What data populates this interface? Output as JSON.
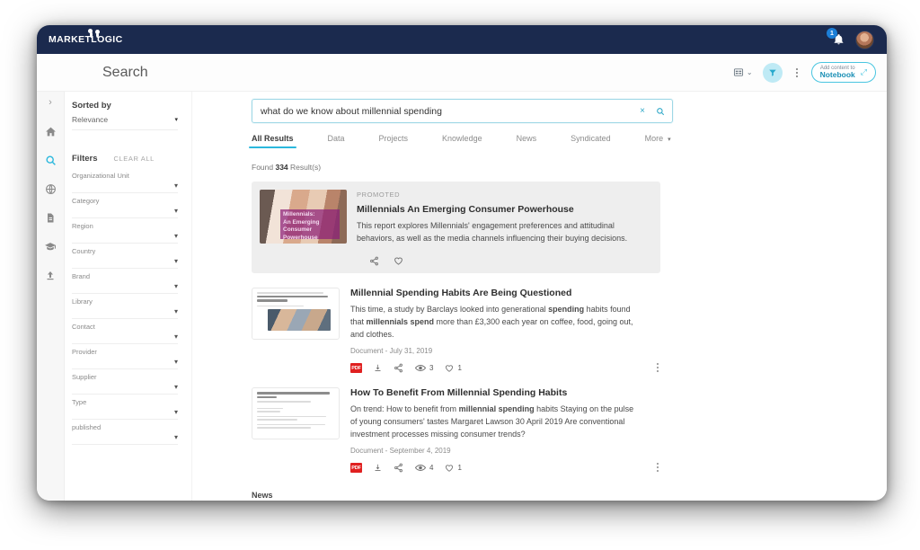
{
  "brand": {
    "logo_text": "MARKETLOGIC",
    "navy": "#1b2a4e",
    "accent_cyan": "#2bb8dd",
    "pdf_red": "#e02020"
  },
  "topbar": {
    "notification_count": "1",
    "bell_icon": "bell-icon",
    "avatar_icon": "user-avatar"
  },
  "pagehead": {
    "title": "Search",
    "view_icon": "view-mode-icon",
    "view_caret": "⌄",
    "filter_icon": "funnel-icon",
    "more_icon": "kebab-menu-icon",
    "notebook": {
      "line1": "Add content to",
      "line2": "Notebook",
      "arrow": "⤢"
    }
  },
  "rail": {
    "expand_caret": "›",
    "items": [
      {
        "name": "home-icon",
        "active": false
      },
      {
        "name": "search-icon",
        "active": true
      },
      {
        "name": "globe-icon",
        "active": false
      },
      {
        "name": "document-icon",
        "active": false
      },
      {
        "name": "academy-icon",
        "active": false
      },
      {
        "name": "upload-icon",
        "active": false
      }
    ]
  },
  "filters_panel": {
    "sorted_by_label": "Sorted by",
    "sorted_by_value": "Relevance",
    "filters_label": "Filters",
    "clear_all_label": "CLEAR ALL",
    "caret": "⌄",
    "items": [
      {
        "label": "Organizational Unit"
      },
      {
        "label": "Category"
      },
      {
        "label": "Region"
      },
      {
        "label": "Country"
      },
      {
        "label": "Brand"
      },
      {
        "label": "Library"
      },
      {
        "label": "Contact"
      },
      {
        "label": "Provider"
      },
      {
        "label": "Supplier"
      },
      {
        "label": "Type"
      },
      {
        "label": "published"
      }
    ]
  },
  "search": {
    "value": "what do we know about millennial spending",
    "placeholder": "Search",
    "clear_icon": "×",
    "search_icon": "search-icon"
  },
  "tabs": [
    {
      "label": "All Results",
      "active": true
    },
    {
      "label": "Data",
      "active": false
    },
    {
      "label": "Projects",
      "active": false
    },
    {
      "label": "Knowledge",
      "active": false
    },
    {
      "label": "News",
      "active": false
    },
    {
      "label": "Syndicated",
      "active": false
    },
    {
      "label": "More",
      "active": false,
      "caret": "▾"
    }
  ],
  "results_header": {
    "prefix": "Found ",
    "count": "334",
    "suffix": " Result(s)"
  },
  "promoted": {
    "label": "PROMOTED",
    "title": "Millennials An Emerging Consumer Powerhouse",
    "description": "This report explores Millennials' engagement preferences and attitudinal behaviors, as well as the media channels influencing their buying decisions.",
    "thumb_overlay": [
      "Millennials:",
      "An Emerging",
      "Consumer Powerhouse"
    ],
    "actions": [
      {
        "name": "share-icon"
      },
      {
        "name": "heart-icon"
      }
    ]
  },
  "results": [
    {
      "title": "Millennial Spending Habits Are Being Questioned",
      "desc_parts": [
        {
          "text": "This time, a study by Barclays looked into generational ",
          "bold": false
        },
        {
          "text": "spending",
          "bold": true
        },
        {
          "text": " habits found that ",
          "bold": false
        },
        {
          "text": "millennials spend",
          "bold": true
        },
        {
          "text": " more than £3,300 each year on coffee, food, going out, and clothes.",
          "bold": false
        }
      ],
      "meta": "Document - July 31, 2019",
      "file_type": "PDF",
      "views": "3",
      "likes": "1"
    },
    {
      "title": "How To Benefit From Millennial Spending Habits",
      "desc_parts": [
        {
          "text": "On trend: How to benefit from ",
          "bold": false
        },
        {
          "text": "millennial spending",
          "bold": true
        },
        {
          "text": " habits Staying on the pulse of young consumers' tastes Margaret Lawson 30 April 2019 Are conventional investment processes missing consumer trends?",
          "bold": false
        }
      ],
      "meta": "Document - September 4, 2019",
      "file_type": "PDF",
      "views": "4",
      "likes": "1"
    }
  ],
  "news_section": {
    "title": "News"
  }
}
